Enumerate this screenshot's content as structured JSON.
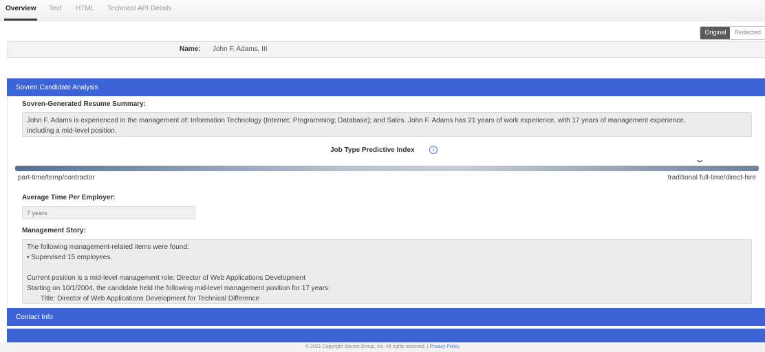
{
  "tabs": [
    "Overview",
    "Text",
    "HTML",
    "Technical API Details"
  ],
  "view_toggle": {
    "original": "Original",
    "redacted": "Redacted"
  },
  "candidate": {
    "name_label": "Name:",
    "name_value": "John F. Adams, III"
  },
  "analysis": {
    "header": "Sovren Candidate Analysis",
    "summary_label": "Sovren-Generated Resume Summary:",
    "summary_lines": [
      "John F. Adams is experienced in the management of:  Information Technology (Internet; Programming; Database); and Sales. John F. Adams has 21 years of work experience, with 17 years of management experience,",
      "including a mid-level position."
    ],
    "predictive_index": {
      "title": "Job Type Predictive Index",
      "info_icon": "info-icon",
      "left_label": "part-time/temp/contractor",
      "right_label": "traditional full-time/direct-hire",
      "indicator_fraction": 0.92
    },
    "avg_time_label": "Average Time Per Employer:",
    "avg_time_value": "7 years",
    "mgmt_label": "Management Story:",
    "mgmt_lines": [
      "The following management-related items were found:",
      "• Supervised 15 employees.",
      "",
      "Current position is a mid-level management role: Director of Web Applications Development",
      "Starting on 10/1/2004, the candidate held the following mid-level management position for 17 years:",
      "Title: Director of Web Applications Development for Technical Difference"
    ]
  },
  "contact": {
    "header": "Contact Info"
  },
  "footer": {
    "text": "© 2021 Copyright Sovren Group, Inc. All rights reserved. |",
    "link": "Privacy Policy"
  },
  "colors": {
    "section_header": "#3d64d6",
    "box_bg": "#ececec",
    "link": "#4a78e0"
  }
}
